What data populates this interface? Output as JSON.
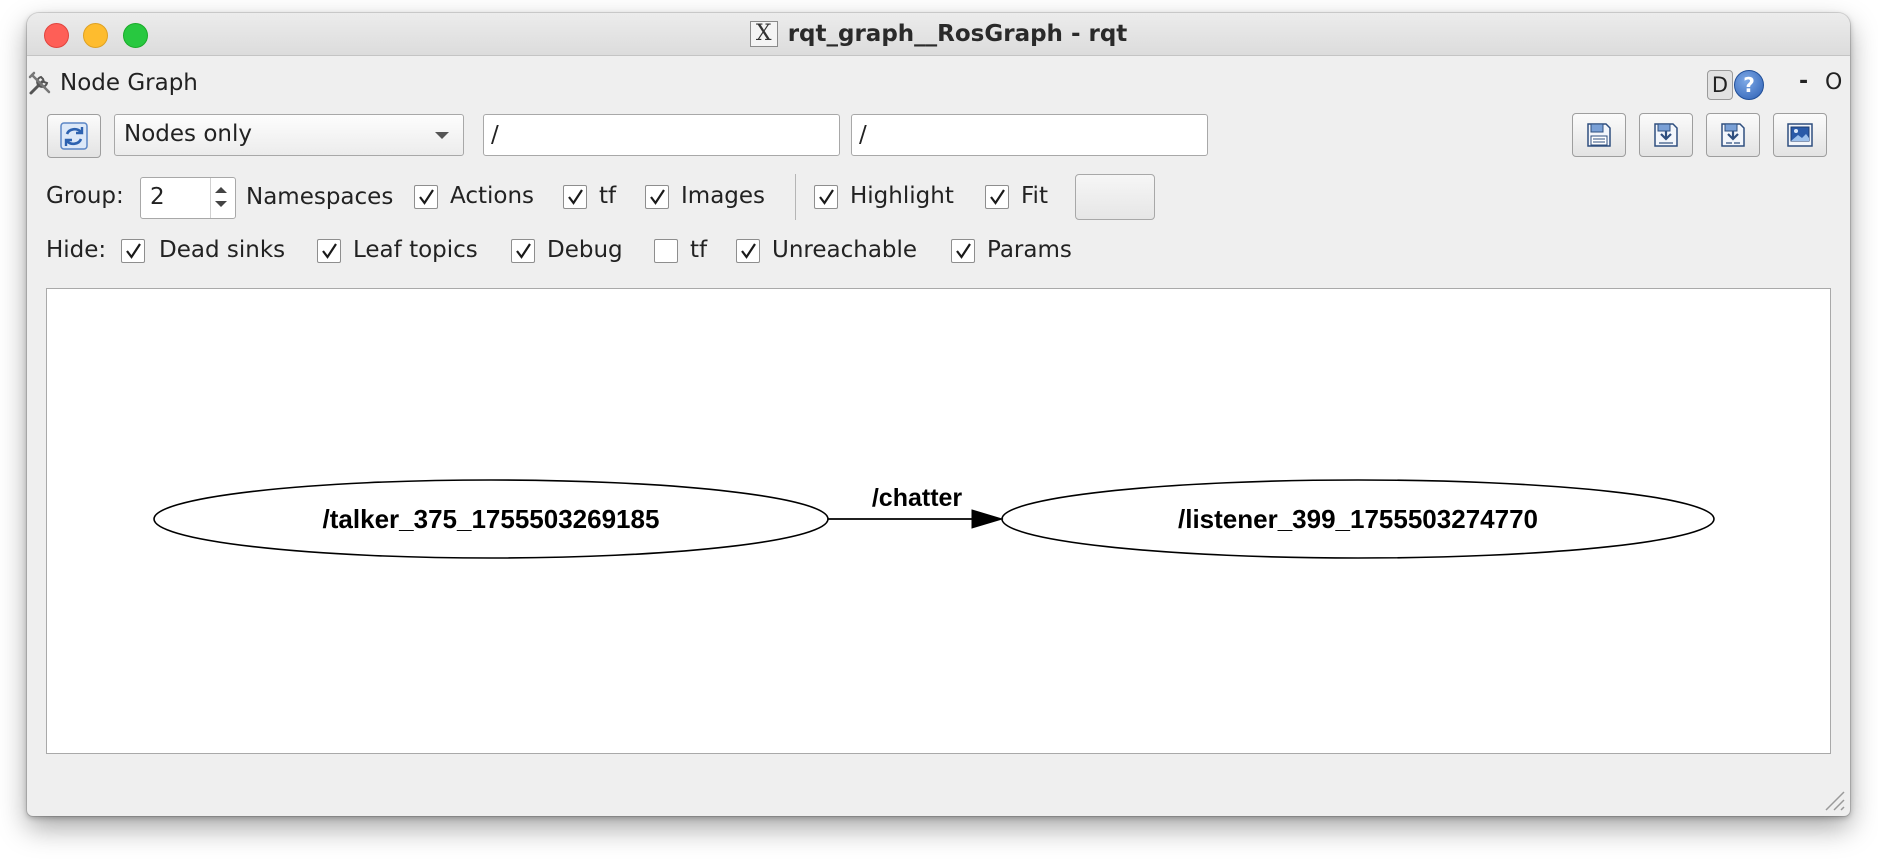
{
  "window": {
    "title": "rqt_graph__RosGraph - rqt",
    "app_icon": "x11-icon",
    "app_icon_glyph": "X"
  },
  "plugin": {
    "title": "Node Graph",
    "icon": "tools-icon",
    "help_d_label": "D",
    "help_glyph": "?",
    "minimize_label": "-",
    "close_label": "O"
  },
  "toolbar": {
    "refresh_icon": "refresh-icon",
    "graph_mode": "Nodes only",
    "namespace_filter": "/",
    "topic_filter": "/",
    "buttons": [
      "load-dot-icon",
      "save-dot-icon",
      "save-svg-icon",
      "save-image-icon"
    ]
  },
  "group_row": {
    "group_label": "Group:",
    "group_value": "2",
    "namespaces_label": "Namespaces",
    "actions_label": "Actions",
    "tf_label": "tf",
    "images_label": "Images",
    "highlight_label": "Highlight",
    "fit_label": "Fit",
    "actions_checked": true,
    "tf_checked": true,
    "images_checked": true,
    "highlight_checked": true,
    "fit_checked": true
  },
  "hide_row": {
    "hide_label": "Hide:",
    "dead_sinks_label": "Dead sinks",
    "leaf_topics_label": "Leaf topics",
    "debug_label": "Debug",
    "tf_label": "tf",
    "unreachable_label": "Unreachable",
    "params_label": "Params",
    "dead_sinks_checked": true,
    "leaf_topics_checked": true,
    "debug_checked": true,
    "tf_checked": false,
    "unreachable_checked": true,
    "params_checked": true
  },
  "graph": {
    "source_node": "/talker_375_1755503269185",
    "target_node": "/listener_399_1755503274770",
    "edge_topic": "/chatter"
  }
}
